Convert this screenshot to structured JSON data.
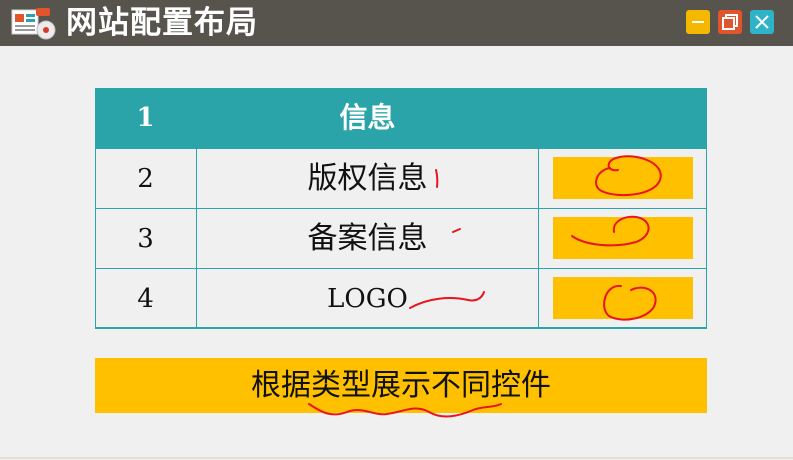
{
  "window": {
    "title": "网站配置布局",
    "icon": "app-icon",
    "controls": [
      "minimize-icon",
      "maximize-icon",
      "close-icon"
    ],
    "colors": {
      "titlebar": "#56544c",
      "minimize": "#f5b800",
      "maximize": "#e2542b",
      "close": "#2fb3c7"
    }
  },
  "table": {
    "header": {
      "num": "1",
      "label": "信息"
    },
    "rows": [
      {
        "num": "2",
        "label": "版权信息"
      },
      {
        "num": "3",
        "label": "备案信息"
      },
      {
        "num": "4",
        "label": "LOGO"
      }
    ],
    "colors": {
      "header": "#2aa4a9",
      "swatch": "#ffc000"
    }
  },
  "banner": {
    "text": "根据类型展示不同控件"
  },
  "annotation": {
    "color": "#e8141e"
  }
}
